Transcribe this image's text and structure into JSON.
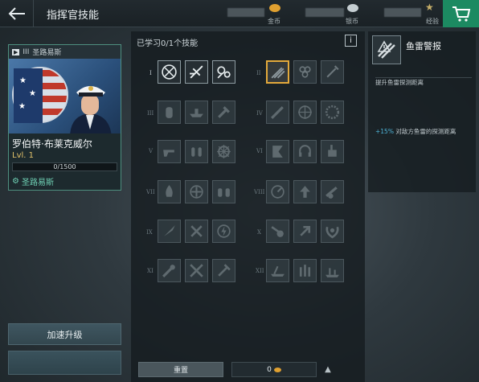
{
  "header": {
    "back_icon": "arrow-left-icon",
    "title": "指挥官技能",
    "currencies": [
      {
        "label": "金币",
        "color": "#e0a030"
      },
      {
        "label": "银币",
        "color": "#b9c3c8"
      },
      {
        "label": "经验",
        "color": "#c8b06a"
      }
    ],
    "cart_icon": "shopping-cart-icon"
  },
  "commander": {
    "rank_tag": "III",
    "nation_header": "圣路易斯",
    "name": "罗伯特·布莱克威尔",
    "level": "Lvl. 1",
    "xp": "0/1500",
    "nation": "圣路易斯",
    "accent": "#6fd0b4"
  },
  "actions": {
    "accelerate": "加速升级"
  },
  "skills": {
    "header": "已学习0/1个技能",
    "info": "i",
    "tiers": [
      {
        "numeral": "I",
        "active": true
      },
      {
        "numeral": "II",
        "active": false
      },
      {
        "numeral": "III",
        "active": false
      },
      {
        "numeral": "IV",
        "active": false
      },
      {
        "numeral": "V",
        "active": false
      },
      {
        "numeral": "VI",
        "active": false
      },
      {
        "numeral": "VII",
        "active": false
      },
      {
        "numeral": "VIII",
        "active": false
      },
      {
        "numeral": "IX",
        "active": false
      },
      {
        "numeral": "X",
        "active": false
      },
      {
        "numeral": "XI",
        "active": false
      },
      {
        "numeral": "XII",
        "active": false
      }
    ],
    "selected_skill": "torpedo-warning-icon",
    "reset_label": "重置",
    "reset_cost": "0",
    "selected_color": "#e3a93b"
  },
  "detail": {
    "title": "鱼雷警报",
    "description": "提升鱼雷探测距离",
    "effect_pct": "+15%",
    "effect_text": "对敌方鱼雷的探测距离"
  }
}
